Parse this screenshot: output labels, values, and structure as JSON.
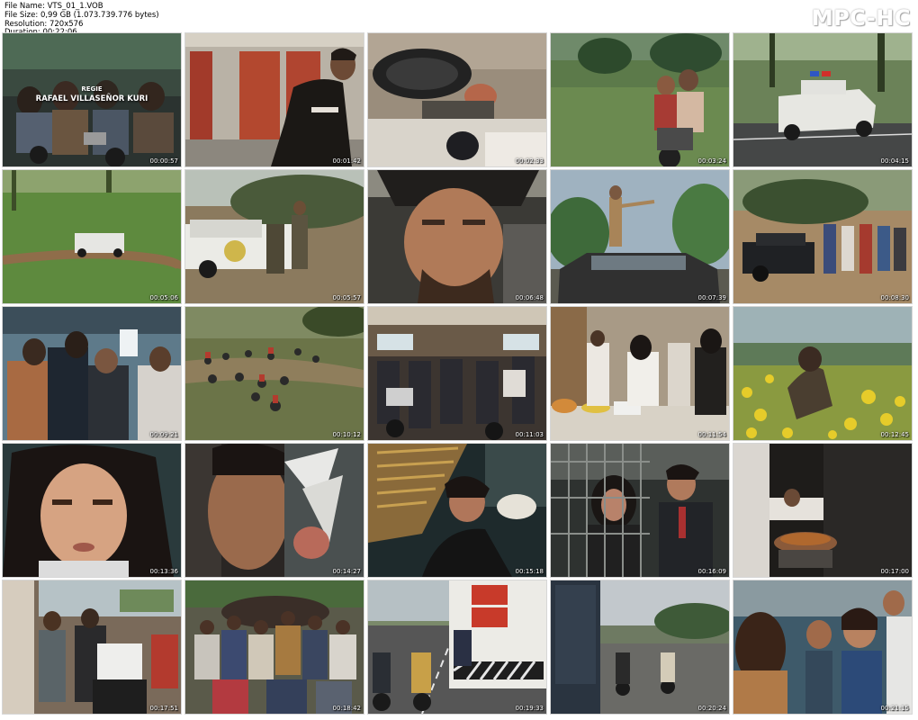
{
  "file_info": {
    "file_name": "File Name: VTS_01_1.VOB",
    "file_size": "File Size: 0,99 GB (1.073.739.776 bytes)",
    "resolution": "Resolution: 720x576",
    "duration": "Duration: 00:22:06"
  },
  "app": {
    "logo": "MPC-HC"
  },
  "thumbnails": [
    {
      "timestamp": "00:00:57",
      "credit_line1": "REGIE",
      "credit_line2": "RAFAEL VILLASEÑOR KURI"
    },
    {
      "timestamp": "00:01:42"
    },
    {
      "timestamp": "00:02:33"
    },
    {
      "timestamp": "00:03:24"
    },
    {
      "timestamp": "00:04:15"
    },
    {
      "timestamp": "00:05:06"
    },
    {
      "timestamp": "00:05:57"
    },
    {
      "timestamp": "00:06:48"
    },
    {
      "timestamp": "00:07:39"
    },
    {
      "timestamp": "00:08:30"
    },
    {
      "timestamp": "00:09:21"
    },
    {
      "timestamp": "00:10:12"
    },
    {
      "timestamp": "00:11:03"
    },
    {
      "timestamp": "00:11:54"
    },
    {
      "timestamp": "00:12:45"
    },
    {
      "timestamp": "00:13:36"
    },
    {
      "timestamp": "00:14:27"
    },
    {
      "timestamp": "00:15:18"
    },
    {
      "timestamp": "00:16:09"
    },
    {
      "timestamp": "00:17:00"
    },
    {
      "timestamp": "00:17:51"
    },
    {
      "timestamp": "00:18:42"
    },
    {
      "timestamp": "00:19:33"
    },
    {
      "timestamp": "00:20:24"
    },
    {
      "timestamp": "00:21:15"
    }
  ]
}
